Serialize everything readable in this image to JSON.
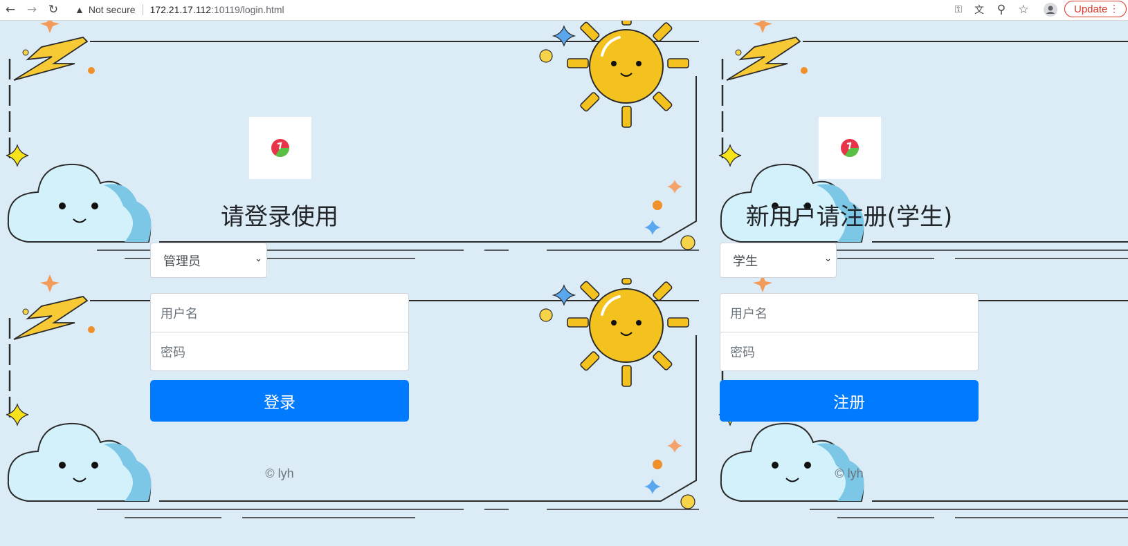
{
  "browser": {
    "security_label": "Not secure",
    "url_host": "172.21.17.112",
    "url_path": ":10119/login.html",
    "update_label": "Update"
  },
  "login": {
    "title": "请登录使用",
    "role_selected": "管理员",
    "username_placeholder": "用户名",
    "password_placeholder": "密码",
    "submit_label": "登录",
    "footer": "© lyh"
  },
  "register": {
    "title": "新用户请注册(学生)",
    "role_selected": "学生",
    "username_placeholder": "用户名",
    "password_placeholder": "密码",
    "submit_label": "注册",
    "footer": "© lyh"
  },
  "colors": {
    "primary": "#007bff",
    "background": "#dcecf6",
    "sun": "#f4c21f",
    "cloud": "#d3f1fb"
  }
}
